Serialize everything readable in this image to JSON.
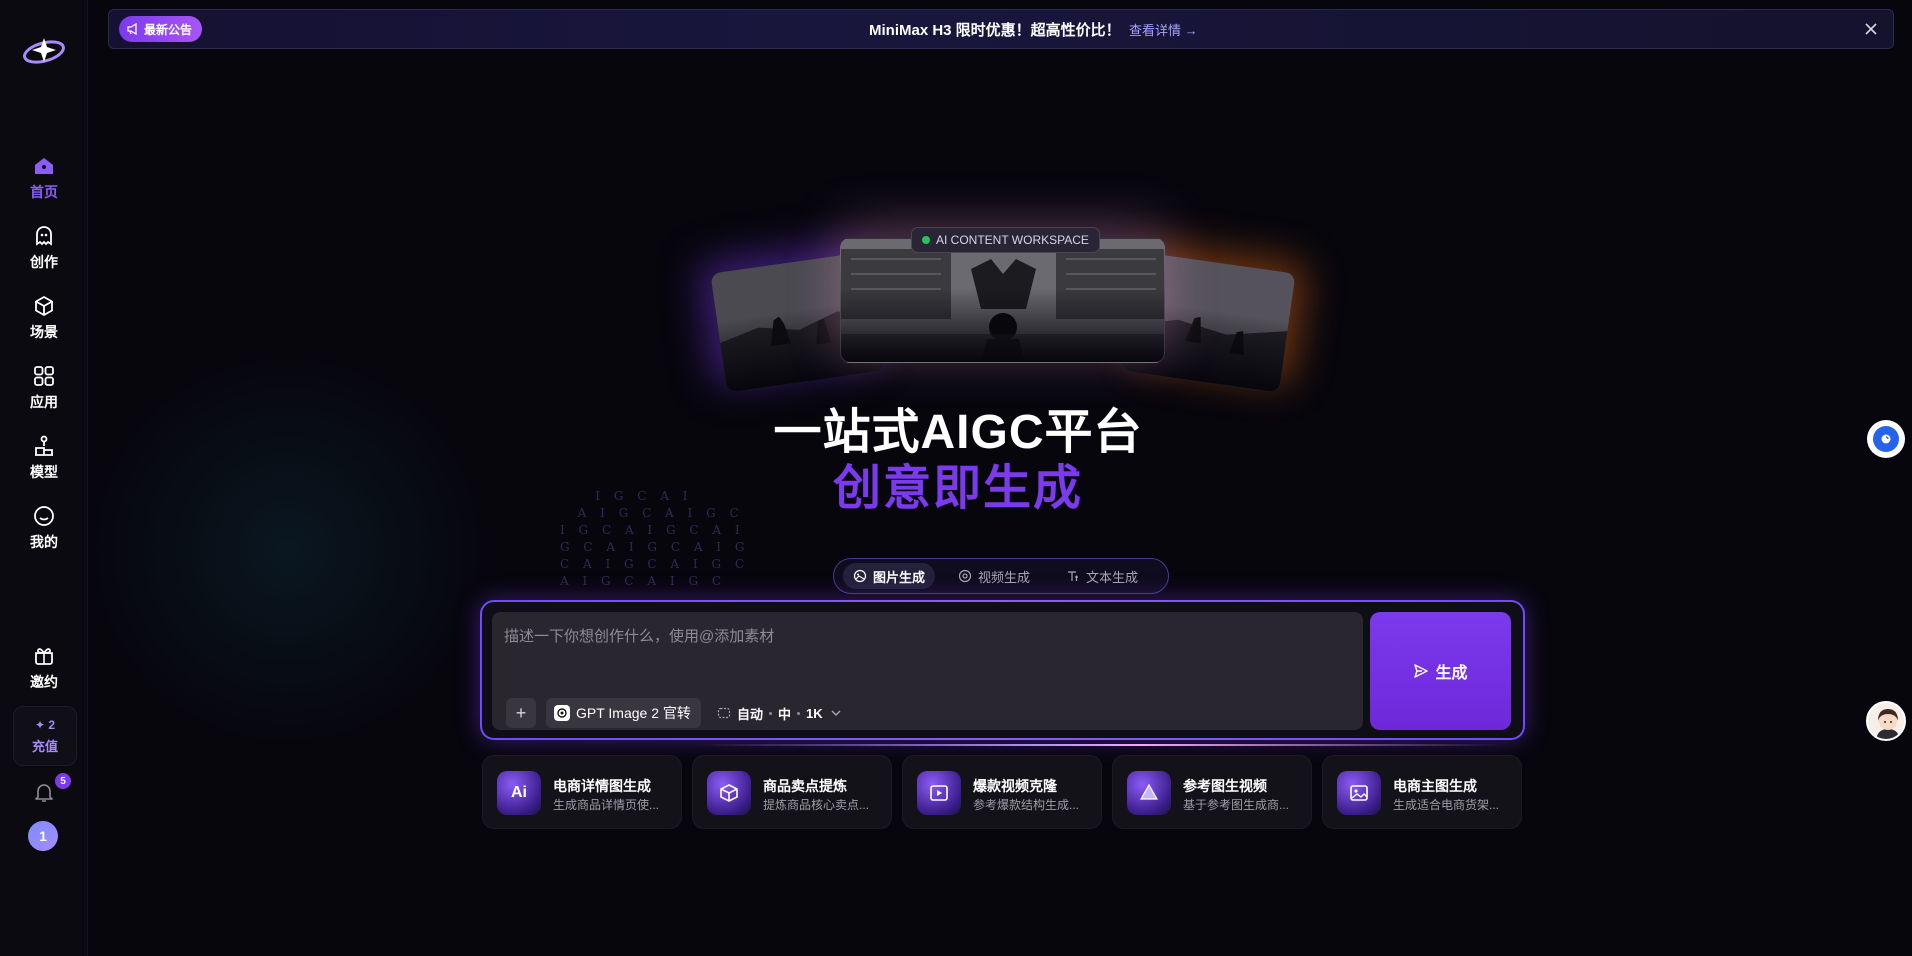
{
  "sidebar": {
    "items": [
      {
        "label": "首页",
        "icon": "home-icon",
        "active": true
      },
      {
        "label": "创作",
        "icon": "ghost-icon",
        "active": false
      },
      {
        "label": "场景",
        "icon": "cube-icon",
        "active": false
      },
      {
        "label": "应用",
        "icon": "grid-icon",
        "active": false
      },
      {
        "label": "模型",
        "icon": "model-icon",
        "active": false
      },
      {
        "label": "我的",
        "icon": "smile-icon",
        "active": false
      }
    ],
    "invite_label": "邀约",
    "recharge": {
      "count": "2",
      "label": "充值"
    },
    "notification_count": "5",
    "avatar_text": "1"
  },
  "announcement": {
    "badge": "最新公告",
    "text": "MiniMax H3 限时优惠！超高性价比！",
    "link": "查看详情 →"
  },
  "hero": {
    "badge": "AI CONTENT WORKSPACE",
    "title": "一站式AIGC平台",
    "subtitle": "创意即生成",
    "matrix_text": "    I G C A I\n  A I G C A I G C\nI G C A I G C A I\nG C A I G C A I G\nC A I G C A I G C\nA I G C A I G C"
  },
  "mode_tabs": [
    {
      "label": "图片生成",
      "active": true
    },
    {
      "label": "视频生成",
      "active": false
    },
    {
      "label": "文本生成",
      "active": false
    }
  ],
  "prompt": {
    "placeholder": "描述一下你想创作什么，使用@添加素材",
    "add_label": "+",
    "model": "GPT Image 2 官转",
    "ratio": "自动",
    "quality": "中",
    "resolution": "1K",
    "generate_label": "生成"
  },
  "quick_actions": [
    {
      "title": "电商详情图生成",
      "desc": "生成商品详情页使...",
      "icon": "ai-icon"
    },
    {
      "title": "商品卖点提炼",
      "desc": "提炼商品核心卖点...",
      "icon": "box-icon"
    },
    {
      "title": "爆款视频克隆",
      "desc": "参考爆款结构生成...",
      "icon": "play-icon"
    },
    {
      "title": "参考图生视频",
      "desc": "基于参考图生成商...",
      "icon": "prism-icon"
    },
    {
      "title": "电商主图生成",
      "desc": "生成适合电商货架...",
      "icon": "image-icon"
    }
  ],
  "colors": {
    "accent": "#7c3aed",
    "background": "#07060d",
    "sidebar": "#0b0a10"
  }
}
